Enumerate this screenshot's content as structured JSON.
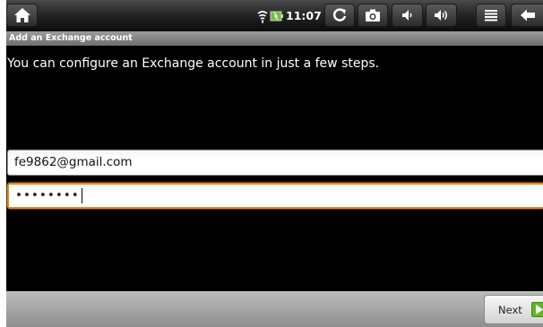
{
  "status_bar": {
    "time": "11:07",
    "icons": [
      "home-icon",
      "wifi-icon",
      "battery-icon",
      "refresh-icon",
      "camera-icon",
      "volume-down-icon",
      "volume-up-icon",
      "menu-icon",
      "back-icon"
    ]
  },
  "screen": {
    "title": "Add an Exchange account",
    "intro": "You can configure an Exchange account in just a few steps."
  },
  "form": {
    "email_value": "fe9862@gmail.com",
    "password_value": "••••••••"
  },
  "footer": {
    "next_label": "Next"
  },
  "colors": {
    "focus_border": "#e08a1e",
    "next_arrow": "#5cb82a"
  }
}
